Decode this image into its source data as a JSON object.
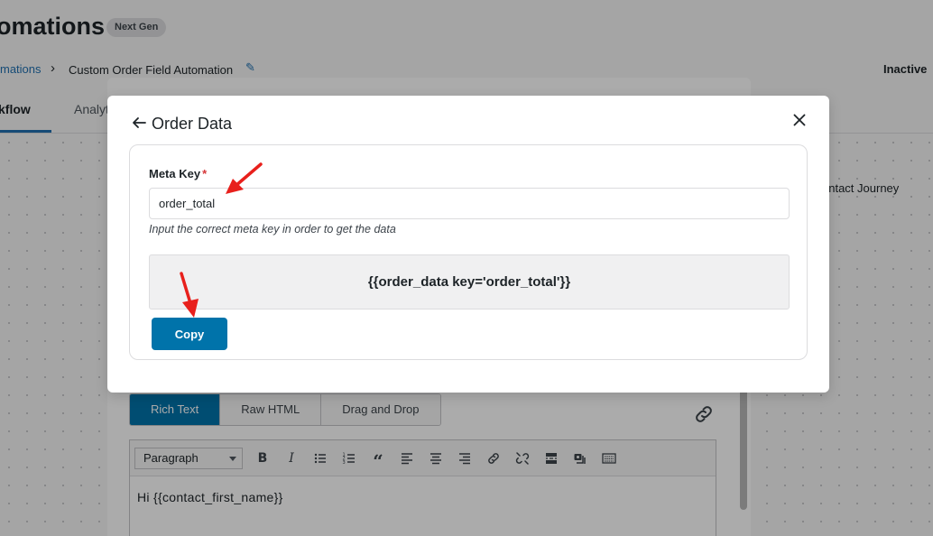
{
  "background": {
    "page_title": "omations",
    "badge": "Next Gen",
    "breadcrumb": {
      "link": "mations",
      "current": "Custom Order Field Automation"
    },
    "status": "Inactive",
    "tabs": [
      "kflow",
      "Analyt"
    ],
    "journey_label": "ontact Journey",
    "editor": {
      "modes": [
        "Rich Text",
        "Raw HTML",
        "Drag and Drop"
      ],
      "active_mode": "Rich Text",
      "format_select": "Paragraph",
      "toolbar_icons": [
        "bold-icon",
        "italic-icon",
        "bullet-list-icon",
        "numbered-list-icon",
        "blockquote-icon",
        "align-left-icon",
        "align-center-icon",
        "align-right-icon",
        "link-icon",
        "unlink-icon",
        "read-more-icon",
        "merge-tags-icon",
        "toolbar-toggle-icon"
      ],
      "body_text": "Hi {{contact_first_name}}"
    }
  },
  "modal": {
    "title": "Order Data",
    "meta_key_label": "Meta Key",
    "required_mark": "*",
    "meta_key_value": "order_total",
    "hint": "Input the correct meta key in order to get the data",
    "shortcode": "{{order_data key='order_total'}}",
    "copy_label": "Copy"
  },
  "colors": {
    "accent": "#0073aa",
    "required": "#d63638",
    "annotation_arrow": "#e8201c"
  }
}
